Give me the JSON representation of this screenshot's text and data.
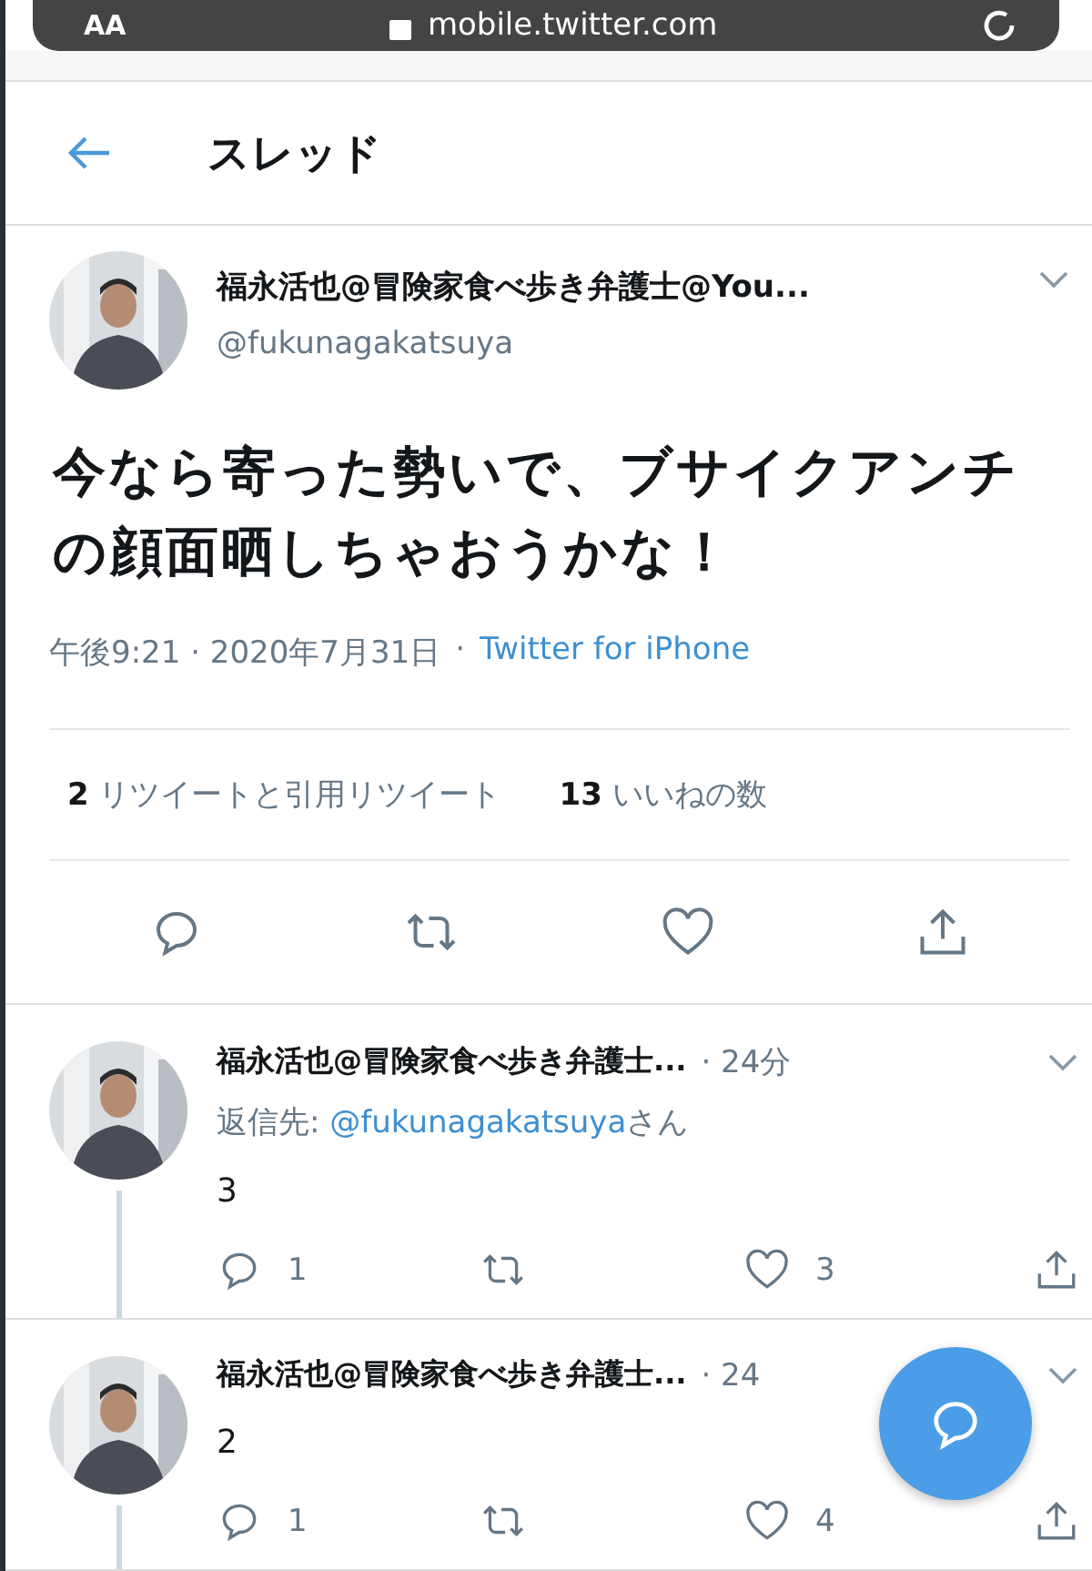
{
  "browser": {
    "text_button": "AA",
    "url": "mobile.twitter.com"
  },
  "header": {
    "title": "スレッド"
  },
  "tweet": {
    "name": "福永活也@冒険家食べ歩き弁護士@You...",
    "handle": "@fukunagakatsuya",
    "text": "今なら寄った勢いで、ブサイクアンチの顔面晒しちゃおうかな！",
    "time": "午後9:21 · 2020年7月31日",
    "separator": "·",
    "source": "Twitter for iPhone",
    "stats": [
      {
        "count": "2",
        "label": "リツイートと引用リツイート"
      },
      {
        "count": "13",
        "label": "いいねの数"
      }
    ]
  },
  "replies": [
    {
      "name": "福永活也@冒険家食べ歩き弁護士...",
      "time": "· 24分",
      "reply_to": {
        "prefix": "返信先: ",
        "handle": "@fukunagakatsuya",
        "suffix": "さん"
      },
      "text": "3",
      "reply_count": "1",
      "like_count": "3"
    },
    {
      "name": "福永活也@冒険家食べ歩き弁護士...",
      "time": "· 24",
      "text": "2",
      "reply_count": "1",
      "like_count": "4"
    }
  ]
}
